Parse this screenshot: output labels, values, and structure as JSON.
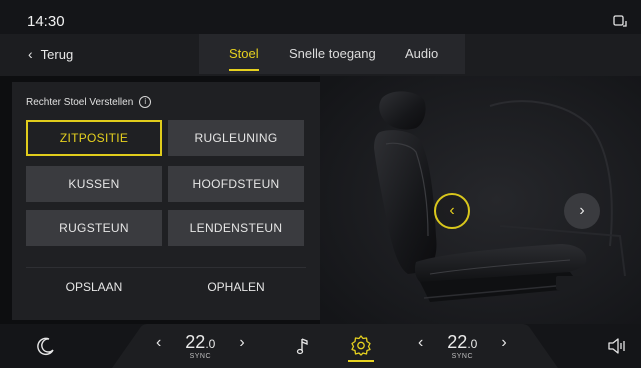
{
  "status": {
    "time": "14:30",
    "icons": [
      "phone-projection-icon"
    ]
  },
  "nav": {
    "back_label": "Terug",
    "tabs": [
      {
        "label": "Stoel",
        "active": true
      },
      {
        "label": "Snelle toegang",
        "active": false
      },
      {
        "label": "Audio",
        "active": false
      }
    ]
  },
  "panel": {
    "title": "Rechter Stoel Verstellen",
    "buttons": [
      {
        "label": "ZITPOSITIE",
        "active": true
      },
      {
        "label": "RUGLEUNING",
        "active": false
      },
      {
        "label": "KUSSEN",
        "active": false
      },
      {
        "label": "HOOFDSTEUN",
        "active": false
      },
      {
        "label": "RUGSTEUN",
        "active": false
      },
      {
        "label": "LENDENSTEUN",
        "active": false
      }
    ],
    "actions": {
      "save": "OPSLAAN",
      "recall": "OPHALEN"
    }
  },
  "bottom": {
    "left_temp": {
      "int": "22",
      "dec": ".0",
      "sync": "SYNC"
    },
    "right_temp": {
      "int": "22",
      "dec": ".0",
      "sync": "SYNC"
    },
    "icons": [
      "moon-icon",
      "music-note-icon",
      "settings-icon",
      "volume-icon"
    ]
  },
  "colors": {
    "accent": "#E6D11F",
    "panel": "#1F2023",
    "button": "#3A3B3F",
    "background": "#0D0E10"
  }
}
